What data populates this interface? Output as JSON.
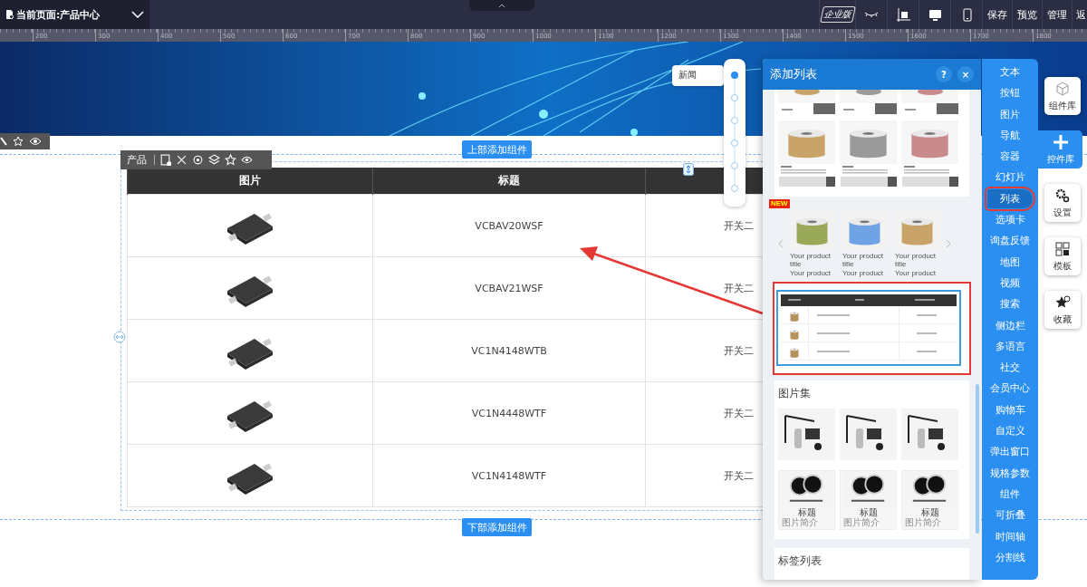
{
  "top_bar": {
    "page_label": "当前页面:产品中心",
    "edition_badge": "企业版",
    "actions": [
      "保存",
      "预览",
      "管理",
      "返"
    ]
  },
  "ruler": {
    "ticks": [
      "200",
      "300",
      "400",
      "500",
      "600",
      "700",
      "800",
      "900",
      "1000",
      "1100",
      "1200",
      "1300",
      "1400",
      "1500",
      "1600",
      "1700",
      "1800"
    ]
  },
  "canvas": {
    "top_add_button": "上部添加组件",
    "component_toolbar": {
      "label": "产品"
    },
    "table": {
      "columns": [
        "图片",
        "标题"
      ],
      "rows": [
        {
          "title": "VCBAV20WSF",
          "column_3": "开关二"
        },
        {
          "title": "VCBAV21WSF",
          "column_3": "开关二"
        },
        {
          "title": "VC1N4148WTB",
          "column_3": "开关二"
        },
        {
          "title": "VC1N4448WTF",
          "column_3": "开关二"
        },
        {
          "title": "VC1N4148WTF",
          "column_3": "开关二"
        }
      ]
    },
    "bottom_add_button": "下部添加组件",
    "timeline": {
      "label": "新闻"
    }
  },
  "add_list_panel": {
    "title": "添加列表",
    "help_button": "?",
    "close_button": "×",
    "new_badge": "NEW",
    "carousel_items": [
      {
        "title": "Your product title",
        "subtitle": "Your product"
      },
      {
        "title": "Your product title",
        "subtitle": "Your product"
      },
      {
        "title": "Your product title",
        "subtitle": "Your product"
      }
    ],
    "gallery": {
      "title": "图片集",
      "captions": [
        {
          "title": "标题",
          "description": "图片简介"
        },
        {
          "title": "标题",
          "description": "图片简介"
        },
        {
          "title": "标题",
          "description": "图片简介"
        }
      ]
    },
    "tag_list": {
      "title": "标签列表"
    }
  },
  "categories": [
    {
      "label": "文本",
      "selected": false
    },
    {
      "label": "按钮",
      "selected": false
    },
    {
      "label": "图片",
      "selected": false
    },
    {
      "label": "导航",
      "selected": false
    },
    {
      "label": "容器",
      "selected": false
    },
    {
      "label": "幻灯片",
      "selected": false
    },
    {
      "label": "列表",
      "selected": true
    },
    {
      "label": "选项卡",
      "selected": false
    },
    {
      "label": "询盘反馈",
      "selected": false
    },
    {
      "label": "地图",
      "selected": false
    },
    {
      "label": "视频",
      "selected": false
    },
    {
      "label": "搜索",
      "selected": false
    },
    {
      "label": "侧边栏",
      "selected": false
    },
    {
      "label": "多语言",
      "selected": false
    },
    {
      "label": "社交",
      "selected": false
    },
    {
      "label": "会员中心",
      "selected": false
    },
    {
      "label": "购物车",
      "selected": false
    },
    {
      "label": "自定义",
      "selected": false
    },
    {
      "label": "弹出窗口",
      "selected": false
    },
    {
      "label": "规格参数",
      "selected": false
    },
    {
      "label": "组件",
      "selected": false
    },
    {
      "label": "可折叠",
      "selected": false
    },
    {
      "label": "时间轴",
      "selected": false
    },
    {
      "label": "分割线",
      "selected": false
    }
  ],
  "side_tabs": [
    {
      "label": "组件库",
      "selected": false
    },
    {
      "label": "控件库",
      "selected": true
    },
    {
      "label": "设置",
      "selected": false
    },
    {
      "label": "模板",
      "selected": false
    },
    {
      "label": "收藏",
      "selected": false
    }
  ]
}
